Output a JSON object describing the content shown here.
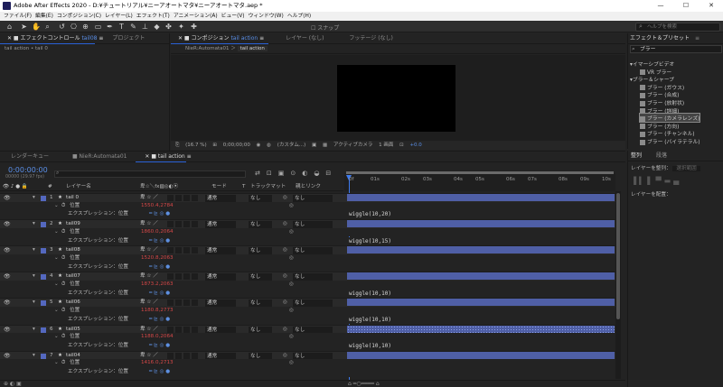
{
  "window": {
    "title": "Adobe After Effects 2020 - D:¥チュートリアル¥ニーアオートマタ¥ニーアオートマタ.aep *",
    "controls": [
      "—",
      "☐",
      "✕"
    ]
  },
  "menu": [
    "ファイル(F)",
    "編集(E)",
    "コンポジション(C)",
    "レイヤー(L)",
    "エフェクト(T)",
    "アニメーション(A)",
    "ビュー(V)",
    "ウィンドウ(W)",
    "ヘルプ(H)"
  ],
  "toolbar": {
    "snap_label": "スナップ",
    "help_search_placeholder": "ヘルプを検索"
  },
  "left_panel": {
    "tab_effect_prefix": "エフェクトコントロール",
    "tab_effect_target": "tail08",
    "tab_project": "プロジェクト",
    "subtitle": "tail action • tail 0"
  },
  "comp_panel": {
    "tab_comp_prefix": "コンポジション",
    "tab_comp_name": "tail action",
    "tab_layer": "レイヤー (なし)",
    "tab_footage": "フッテージ (なし)",
    "breadcrumb": [
      "NieR:Automata01",
      "tail action"
    ],
    "viewer_bar": {
      "zoom": "(16.7 %)",
      "timecode": "0;00;00;00",
      "resolution": "(カスタム...)",
      "camera": "アクティブカメラ",
      "views": "1 画面",
      "exposure": "+0.0"
    }
  },
  "effects_panel": {
    "tab_title": "エフェクト＆プリセット",
    "search_value": "ブラー",
    "items": [
      {
        "label": "イマーシブビデオ",
        "type": "category"
      },
      {
        "label": "VR ブラー",
        "type": "effect"
      },
      {
        "label": "ブラー＆シャープ",
        "type": "category"
      },
      {
        "label": "ブラー (ガウス)",
        "type": "effect"
      },
      {
        "label": "ブラー (合成)",
        "type": "effect"
      },
      {
        "label": "ブラー (放射状)",
        "type": "effect"
      },
      {
        "label": "ブラー (詳細)",
        "type": "effect"
      },
      {
        "label": "ブラー (カメラレンズ)",
        "type": "effect",
        "selected": true
      },
      {
        "label": "ブラー (方向)",
        "type": "effect"
      },
      {
        "label": "ブラー (チャンネル)",
        "type": "effect"
      },
      {
        "label": "ブラー (バイラテラル)",
        "type": "effect"
      }
    ]
  },
  "align_panel": {
    "tab_align": "整列",
    "tab_paragraph": "段落",
    "align_to_label": "レイヤーを整列：",
    "align_to_value": "選択範囲",
    "distribute_label": "レイヤーを配置："
  },
  "timeline": {
    "tabs": [
      "レンダーキュー",
      "NieR:Automata01",
      "tail action"
    ],
    "timecode": "0:00:00:00",
    "timecode_sub": "00000 (29.97 fps)",
    "columns": {
      "layer_name": "レイヤー名",
      "mode": "モード",
      "t": "T",
      "track_matte": "トラックマット",
      "parent": "親とリンク"
    },
    "ruler": [
      "0f",
      "02s",
      "04s",
      "06s",
      "08s",
      "10s"
    ],
    "ruler_minor": [
      "01s",
      "03s",
      "05s",
      "07s",
      "09s"
    ],
    "prop_position": "位置",
    "expression_label": "エクスプレッション：位置",
    "mode_value": "通常",
    "parent_value": "なし",
    "track_none": "なし",
    "layers": [
      {
        "num": "1",
        "name": "tail 0",
        "pos": "1550.4,2784",
        "expr": "wiggle(10,20)"
      },
      {
        "num": "2",
        "name": "tail09",
        "pos": "1860.0,2064",
        "expr": "wiggle(10,15)"
      },
      {
        "num": "3",
        "name": "tail08",
        "pos": "1520.8,2063"
      },
      {
        "num": "4",
        "name": "tail07",
        "pos": "1873.2,2063",
        "expr": "wiggle(10,10)"
      },
      {
        "num": "5",
        "name": "tail06",
        "pos": "1180.8,2773",
        "expr": "wiggle(10,10)"
      },
      {
        "num": "6",
        "name": "tail05",
        "pos": "1188.0,2064",
        "expr": "wiggle(10,10)"
      },
      {
        "num": "7",
        "name": "tail04",
        "pos": "1416.0,2713"
      }
    ]
  }
}
